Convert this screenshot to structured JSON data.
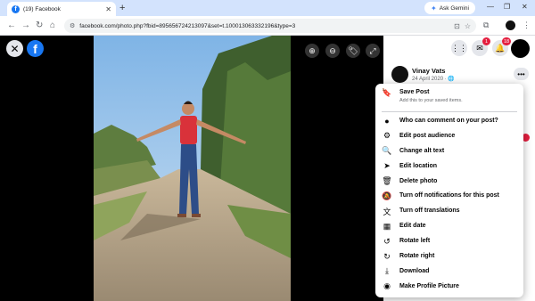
{
  "browser": {
    "tab_title": "(19) Facebook",
    "tab_close": "✕",
    "new_tab": "+",
    "gemini_label": "Ask Gemini",
    "url": "facebook.com/photo.php?fbid=895656724213097&set=t.100013063332196&type=3",
    "win_minimize": "—",
    "win_restore": "❐",
    "win_close": "✕"
  },
  "viewer": {
    "close": "✕",
    "logo": "f",
    "controls": {
      "zoom_in": "⊕",
      "zoom_out": "⊖",
      "tag": "🏷",
      "fullscreen": "⤢"
    }
  },
  "topbar": {
    "messenger_badge": "1",
    "notifications_badge": "18"
  },
  "post": {
    "author": "Vinay Vats",
    "date": "24 April 2020 · 🌐",
    "more": "•••"
  },
  "menu": {
    "save": {
      "label": "Save Post",
      "sub": "Add this to your saved items."
    },
    "items": [
      {
        "label": "Who can comment on your post?",
        "icon": "comment-bubble-icon",
        "glyph": "●"
      },
      {
        "label": "Edit post audience",
        "icon": "gear-icon",
        "glyph": "⚙"
      },
      {
        "label": "Change alt text",
        "icon": "magnifier-icon",
        "glyph": "🔍"
      },
      {
        "label": "Edit location",
        "icon": "location-arrow-icon",
        "glyph": "➤"
      },
      {
        "label": "Delete photo",
        "icon": "trash-icon",
        "glyph": "🗑"
      },
      {
        "label": "Turn off notifications for this post",
        "icon": "bell-off-icon",
        "glyph": "🔕"
      },
      {
        "label": "Turn off translations",
        "icon": "translate-icon",
        "glyph": "文"
      },
      {
        "label": "Edit date",
        "icon": "calendar-icon",
        "glyph": "▦"
      },
      {
        "label": "Rotate left",
        "icon": "rotate-left-icon",
        "glyph": "↺"
      },
      {
        "label": "Rotate right",
        "icon": "rotate-right-icon",
        "glyph": "↻"
      },
      {
        "label": "Download",
        "icon": "download-icon",
        "glyph": "⤓"
      },
      {
        "label": "Make Profile Picture",
        "icon": "profile-picture-icon",
        "glyph": "◉"
      }
    ]
  },
  "colors": {
    "accent": "#1877f2",
    "badge": "#e41e3f"
  }
}
